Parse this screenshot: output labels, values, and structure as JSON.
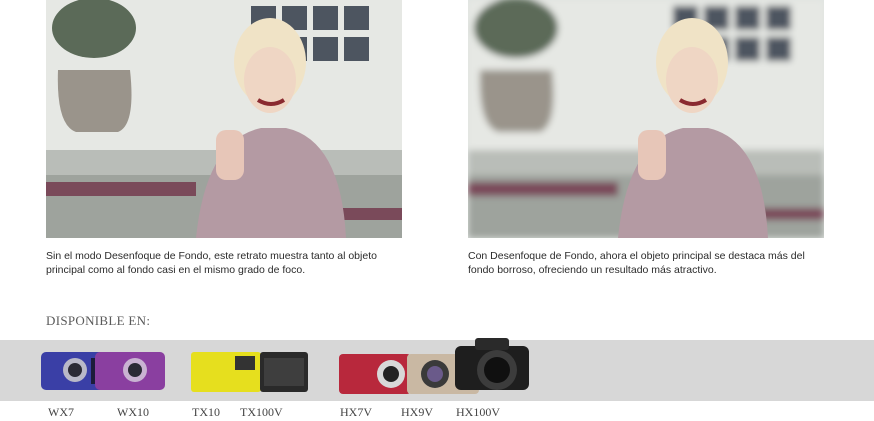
{
  "photos": [
    {
      "caption": "Sin el modo Desenfoque de Fondo, este retrato muestra tanto al objeto principal como al fondo casi en el mismo grado de foco."
    },
    {
      "caption": "Con Desenfoque de Fondo, ahora el objeto principal se destaca más del fondo borroso, ofreciendo un resultado más atractivo."
    }
  ],
  "availability": {
    "title": "DISPONIBLE EN:",
    "models": [
      "WX7",
      "WX10",
      "TX10",
      "TX100V",
      "HX7V",
      "HX9V",
      "HX100V"
    ]
  },
  "colors": {
    "band": "#d7d7d7",
    "wx7": "#3a3fa6",
    "wx10": "#8a3fa0",
    "tx10": "#e6df1e",
    "tx100v": "#2a2a2a",
    "hx7v": "#b8283c",
    "hx9v": "#c9b8a3",
    "hx100v": "#1e1e1e"
  }
}
